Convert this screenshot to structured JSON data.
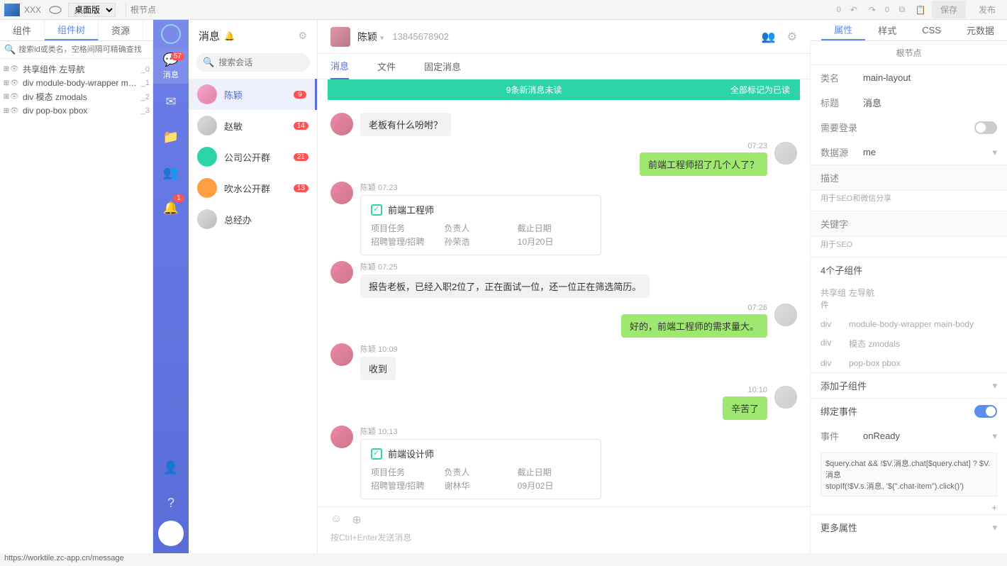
{
  "topbar": {
    "title": "XXX",
    "view_select": "桌面版",
    "breadcrumb": "根节点",
    "undo_count": "0",
    "redo_count": "0",
    "save": "保存",
    "publish": "发布"
  },
  "left_tabs": {
    "components": "组件",
    "tree": "组件树",
    "resources": "资源"
  },
  "tree": {
    "search_placeholder": "搜索id或类名，空格间隔可精确查找",
    "rows": [
      {
        "exp": "⊞",
        "label": "共享组件 左导航",
        "idx": "_0"
      },
      {
        "exp": "⊞",
        "label": "div  module-body-wrapper main-body",
        "idx": "_1"
      },
      {
        "exp": "⊞",
        "label": "div  模态 zmodals",
        "idx": "_2"
      },
      {
        "exp": "⊞",
        "label": "div  pop-box pbox",
        "idx": "_3"
      }
    ]
  },
  "rail": {
    "items": [
      {
        "name": "messages",
        "label": "消息",
        "badge": "57",
        "active": true
      },
      {
        "name": "inbox",
        "label": "",
        "badge": ""
      },
      {
        "name": "files",
        "label": "",
        "badge": ""
      },
      {
        "name": "contacts",
        "label": "",
        "badge": ""
      },
      {
        "name": "activity",
        "label": "",
        "badge": "1"
      }
    ]
  },
  "convo": {
    "title": "消息",
    "search_placeholder": "搜索会话",
    "items": [
      {
        "name": "陈颖",
        "badge": "9",
        "active": true,
        "avcls": "av-pink"
      },
      {
        "name": "赵敏",
        "badge": "14",
        "avcls": "av-gray"
      },
      {
        "name": "公司公开群",
        "badge": "21",
        "avcls": "av-teal"
      },
      {
        "name": "吹水公开群",
        "badge": "13",
        "avcls": "av-orange"
      },
      {
        "name": "总经办",
        "badge": "",
        "avcls": "av-gray"
      }
    ]
  },
  "chat": {
    "name": "陈颖",
    "phone": "13845678902",
    "tabs": {
      "msg": "消息",
      "file": "文件",
      "pinned": "固定消息"
    },
    "unread_left": "9条新消息未读",
    "unread_right": "全部标记为已读",
    "messages": [
      {
        "side": "left",
        "meta": "",
        "type": "text",
        "text": "老板有什么吩咐？"
      },
      {
        "side": "right",
        "meta": "07:23",
        "type": "text",
        "text": "前端工程师招了几个人了？"
      },
      {
        "side": "left",
        "meta": "陈颖  07:23",
        "type": "card",
        "card": {
          "title": "前端工程师",
          "col1l": "项目任务",
          "col1v": "招聘管理/招聘",
          "col2l": "负责人",
          "col2v": "孙荣浩",
          "col3l": "截止日期",
          "col3v": "10月20日"
        }
      },
      {
        "side": "left",
        "meta": "陈颖  07:25",
        "type": "text",
        "text": "报告老板，已经入职2位了，正在面试一位，还一位正在筛选简历。"
      },
      {
        "side": "right",
        "meta": "07:26",
        "type": "text",
        "text": "好的，前端工程师的需求量大。"
      },
      {
        "side": "left",
        "meta": "陈颖  10:09",
        "type": "text",
        "text": "收到"
      },
      {
        "side": "right",
        "meta": "10:10",
        "type": "text",
        "text": "辛苦了"
      },
      {
        "side": "left",
        "meta": "陈颖  10:13",
        "type": "card",
        "card": {
          "title": "前端设计师",
          "col1l": "项目任务",
          "col1v": "招聘管理/招聘",
          "col2l": "负责人",
          "col2v": "谢林华",
          "col3l": "截止日期",
          "col3v": "09月02日"
        }
      }
    ],
    "input_hint": "按Ctrl+Enter发送消息"
  },
  "right_tabs": {
    "props": "属性",
    "style": "样式",
    "css": "CSS",
    "meta": "元数据"
  },
  "props": {
    "breadcrumb": "根节点",
    "class_label": "类名",
    "class_val": "main-layout",
    "title_label": "标题",
    "title_val": "消息",
    "login_label": "需要登录",
    "ds_label": "数据源",
    "ds_val": "me",
    "desc_label": "描述",
    "desc_hint": "用于SEO和微信分享",
    "kw_label": "关键字",
    "kw_hint": "用于SEO",
    "children_header": "4个子组件",
    "shared_label": "共享组件",
    "shared_val": "左导航",
    "children": [
      {
        "tag": "div",
        "label": "module-body-wrapper main-body"
      },
      {
        "tag": "div",
        "label": "模态 zmodals"
      },
      {
        "tag": "div",
        "label": "pop-box pbox"
      }
    ],
    "add_child": "添加子组件",
    "bind_event": "绑定事件",
    "event_label": "事件",
    "event_val": "onReady",
    "code": "$query.chat && !$V.消息.chat[$query.chat] ? $V.消息\nstopIf(!$V.s.消息, '$(\".chat-item\").click()')",
    "more": "更多属性"
  },
  "statusbar": "https://worktile.zc-app.cn/message"
}
